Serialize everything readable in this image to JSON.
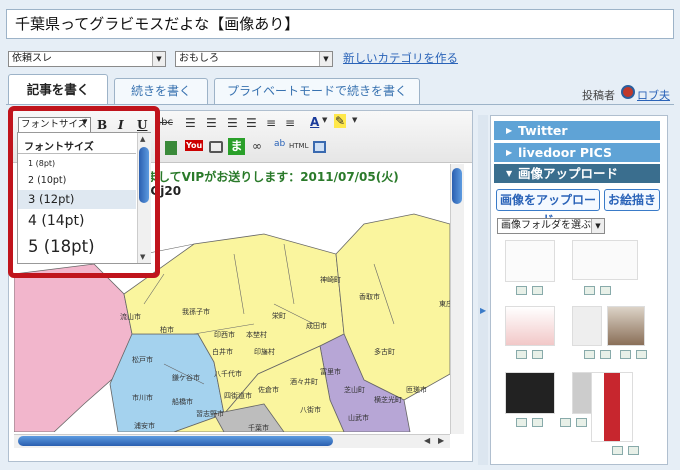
{
  "title": "千葉県ってグラビモスだよな【画像あり】",
  "select1": "依頼スレ",
  "select2": "おもしろ",
  "new_category": "新しいカテゴリを作る",
  "tabs": [
    "記事を書く",
    "続きを書く",
    "プライベートモードで続きを書く"
  ],
  "poster_label": "投稿者",
  "poster_name": "ロブ夫",
  "toolbar": {
    "font_select": "フォントサイズ",
    "bold": "B",
    "italic": "I",
    "underline": "U"
  },
  "dropdown": {
    "header": "フォントサイズ",
    "items": [
      "1 (8pt)",
      "2 (10pt)",
      "3 (12pt)",
      "4 (14pt)",
      "5 (18pt)"
    ],
    "selected": "3 (12pt)"
  },
  "content": {
    "line1_prefix": "まして",
    "line1_bold": "VIP",
    "line1_rest": "がお送りします：2011/07/05(火)",
    "line2": "/Gj20"
  },
  "map_labels": [
    "神崎町",
    "香取市",
    "東庄",
    "成田市",
    "栄町",
    "印西市",
    "本埜村",
    "白井市",
    "我孫子市",
    "柏市",
    "流山市",
    "松戸市",
    "市川市",
    "浦安市",
    "船橋市",
    "鎌ケ谷市",
    "八千代市",
    "習志野市",
    "佐倉市",
    "四街道市",
    "酒々井町",
    "富里市",
    "多古町",
    "芝山町",
    "横芝光町",
    "匝瑳市",
    "八街市",
    "山武市",
    "千葉市",
    "印旛村"
  ],
  "side": {
    "sections": [
      "Twitter",
      "livedoor PICS",
      "画像アップロード"
    ],
    "upload_button": "画像をアップロード",
    "draw_button": "お絵描き",
    "folder_select": "画像フォルダを選ぶ"
  },
  "colors": {
    "accent": "#5fa3d6",
    "highlight": "#c0141c",
    "link": "#2a63b8"
  }
}
